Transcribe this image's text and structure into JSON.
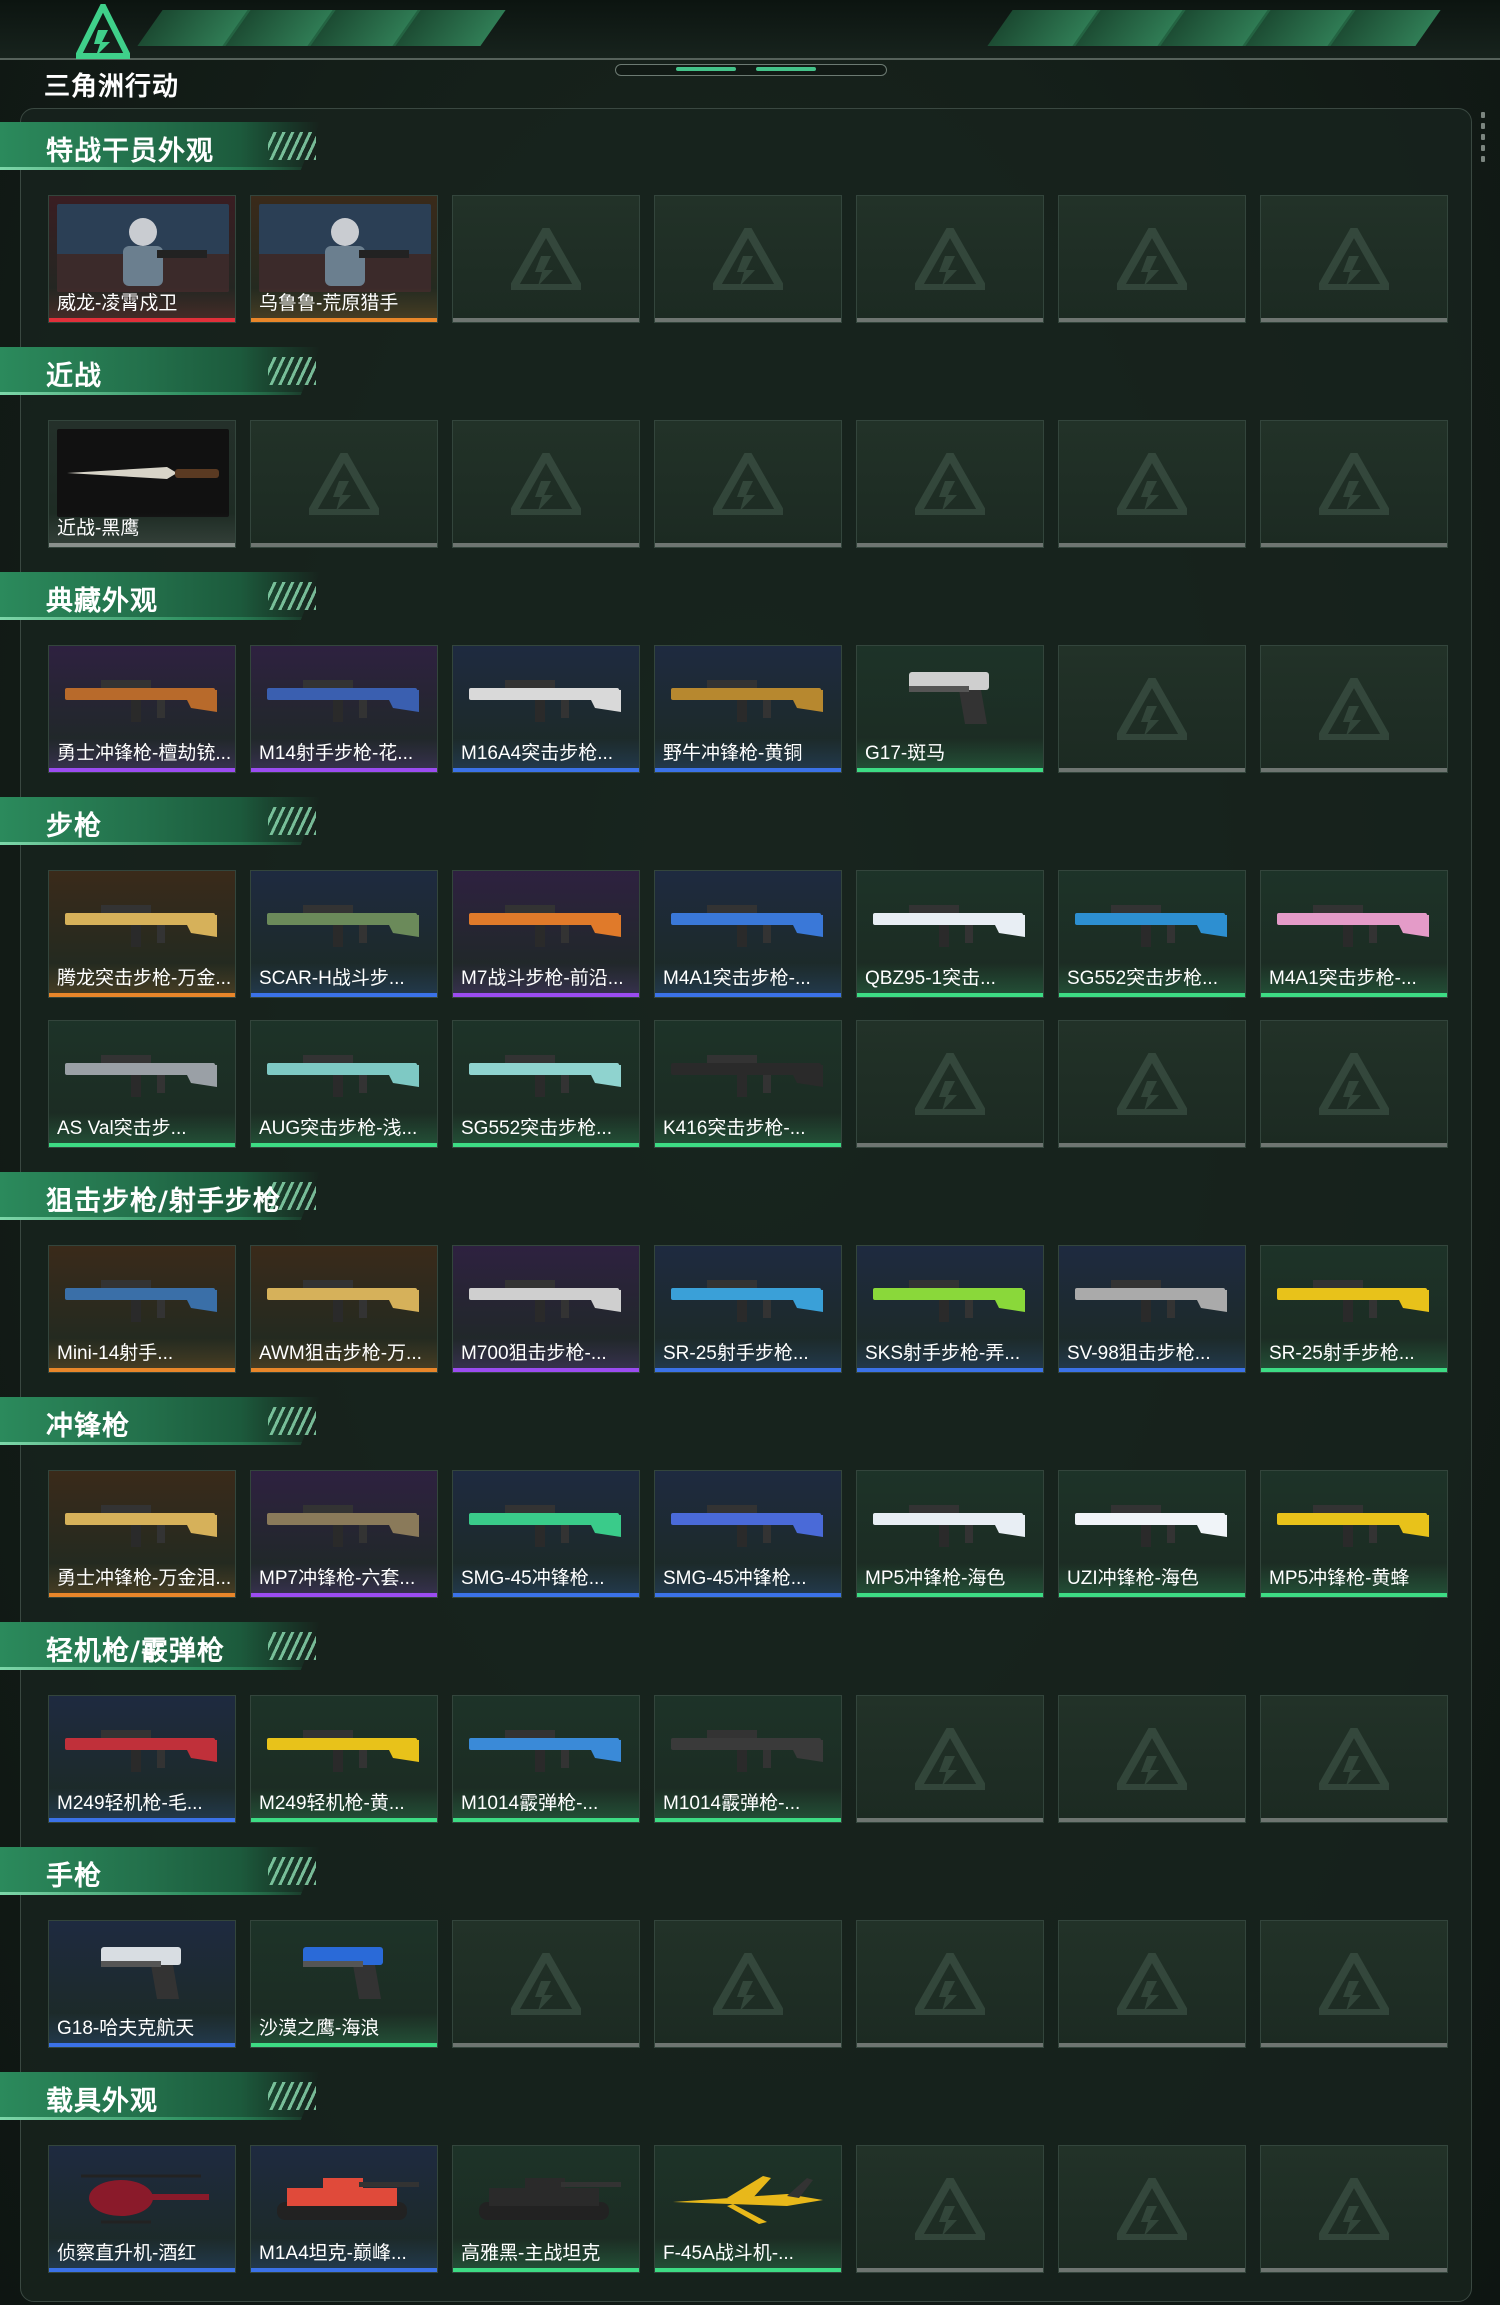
{
  "app": {
    "logo_text": "三角洲行动"
  },
  "rarity_colors": {
    "red": "#e0303a",
    "orange": "#e8862a",
    "purple": "#9b4cf0",
    "blue": "#3b72e8",
    "green": "#3ddc84",
    "gray": "#8a918d"
  },
  "sections": [
    {
      "title": "特战干员外观",
      "items": [
        {
          "label": "威龙-凌霄戍卫",
          "rarity": "red",
          "icon": "operator-portrait"
        },
        {
          "label": "乌鲁鲁-荒原猎手",
          "rarity": "orange",
          "icon": "operator-portrait"
        }
      ]
    },
    {
      "title": "近战",
      "items": [
        {
          "label": "近战-黑鹰",
          "rarity": "gray",
          "icon": "knife-icon"
        }
      ]
    },
    {
      "title": "典藏外观",
      "items": [
        {
          "label": "勇士冲锋枪-檀劫铳...",
          "rarity": "purple",
          "icon": "smg-icon",
          "color": "#b86a2b"
        },
        {
          "label": "M14射手步枪-花...",
          "rarity": "purple",
          "icon": "rifle-icon",
          "color": "#3a5fb0"
        },
        {
          "label": "M16A4突击步枪...",
          "rarity": "blue",
          "icon": "rifle-icon",
          "color": "#d9d9d9"
        },
        {
          "label": "野牛冲锋枪-黄铜",
          "rarity": "blue",
          "icon": "smg-icon",
          "color": "#b7882f"
        },
        {
          "label": "G17-斑马",
          "rarity": "green",
          "icon": "pistol-icon",
          "color": "#cfcfcf"
        }
      ]
    },
    {
      "title": "步枪",
      "rows": [
        [
          {
            "label": "腾龙突击步枪-万金...",
            "rarity": "orange",
            "icon": "rifle-icon",
            "color": "#d6b15a"
          },
          {
            "label": "SCAR-H战斗步...",
            "rarity": "blue",
            "icon": "rifle-icon",
            "color": "#6b8a5a"
          },
          {
            "label": "M7战斗步枪-前沿...",
            "rarity": "purple",
            "icon": "rifle-icon",
            "color": "#e07a2a"
          },
          {
            "label": "M4A1突击步枪-...",
            "rarity": "blue",
            "icon": "rifle-icon",
            "color": "#3a78d8"
          },
          {
            "label": "QBZ95-1突击...",
            "rarity": "green",
            "icon": "rifle-icon",
            "color": "#e8eef4"
          },
          {
            "label": "SG552突击步枪...",
            "rarity": "green",
            "icon": "rifle-icon",
            "color": "#2d8fd1"
          },
          {
            "label": "M4A1突击步枪-...",
            "rarity": "green",
            "icon": "rifle-icon",
            "color": "#e49bc8"
          }
        ],
        [
          {
            "label": "AS Val突击步...",
            "rarity": "green",
            "icon": "rifle-icon",
            "color": "#9aa0a6"
          },
          {
            "label": "AUG突击步枪-浅...",
            "rarity": "green",
            "icon": "rifle-icon",
            "color": "#7ec9c4"
          },
          {
            "label": "SG552突击步枪...",
            "rarity": "green",
            "icon": "rifle-icon",
            "color": "#8fd3cf"
          },
          {
            "label": "K416突击步枪-...",
            "rarity": "green",
            "icon": "rifle-icon",
            "color": "#2a2a2a"
          }
        ]
      ]
    },
    {
      "title": "狙击步枪/射手步枪",
      "items": [
        {
          "label": "Mini-14射手...",
          "rarity": "orange",
          "icon": "sniper-icon",
          "color": "#3a6fa8"
        },
        {
          "label": "AWM狙击步枪-万...",
          "rarity": "orange",
          "icon": "sniper-icon",
          "color": "#d6b15a"
        },
        {
          "label": "M700狙击步枪-...",
          "rarity": "purple",
          "icon": "sniper-icon",
          "color": "#cfcfcf"
        },
        {
          "label": "SR-25射手步枪...",
          "rarity": "blue",
          "icon": "sniper-icon",
          "color": "#3aa0d8"
        },
        {
          "label": "SKS射手步枪-弄...",
          "rarity": "blue",
          "icon": "sniper-icon",
          "color": "#8ad83a"
        },
        {
          "label": "SV-98狙击步枪...",
          "rarity": "blue",
          "icon": "sniper-icon",
          "color": "#aaaaaa"
        },
        {
          "label": "SR-25射手步枪...",
          "rarity": "green",
          "icon": "sniper-icon",
          "color": "#e8c21a"
        }
      ]
    },
    {
      "title": "冲锋枪",
      "items": [
        {
          "label": "勇士冲锋枪-万金泪...",
          "rarity": "orange",
          "icon": "smg-icon",
          "color": "#d6b15a"
        },
        {
          "label": "MP7冲锋枪-六套...",
          "rarity": "purple",
          "icon": "smg-icon",
          "color": "#8a7a5a"
        },
        {
          "label": "SMG-45冲锋枪...",
          "rarity": "blue",
          "icon": "smg-icon",
          "color": "#3acb8a"
        },
        {
          "label": "SMG-45冲锋枪...",
          "rarity": "blue",
          "icon": "smg-icon",
          "color": "#4a6ad8"
        },
        {
          "label": "MP5冲锋枪-海色",
          "rarity": "green",
          "icon": "smg-icon",
          "color": "#e8eef4"
        },
        {
          "label": "UZI冲锋枪-海色",
          "rarity": "green",
          "icon": "smg-icon",
          "color": "#f0f4f8"
        },
        {
          "label": "MP5冲锋枪-黄蜂",
          "rarity": "green",
          "icon": "smg-icon",
          "color": "#e8c21a"
        }
      ]
    },
    {
      "title": "轻机枪/霰弹枪",
      "items": [
        {
          "label": "M249轻机枪-毛...",
          "rarity": "blue",
          "icon": "lmg-icon",
          "color": "#c0303a"
        },
        {
          "label": "M249轻机枪-黄...",
          "rarity": "green",
          "icon": "lmg-icon",
          "color": "#e8c21a"
        },
        {
          "label": "M1014霰弹枪-...",
          "rarity": "green",
          "icon": "shotgun-icon",
          "color": "#3a8ad8"
        },
        {
          "label": "M1014霰弹枪-...",
          "rarity": "green",
          "icon": "shotgun-icon",
          "color": "#3a3a3a"
        }
      ]
    },
    {
      "title": "手枪",
      "items": [
        {
          "label": "G18-哈夫克航天",
          "rarity": "blue",
          "icon": "pistol-icon",
          "color": "#d8dde2"
        },
        {
          "label": "沙漠之鹰-海浪",
          "rarity": "green",
          "icon": "pistol-icon",
          "color": "#2a6ad8"
        }
      ]
    },
    {
      "title": "载具外观",
      "items": [
        {
          "label": "侦察直升机-酒红",
          "rarity": "blue",
          "icon": "helicopter-icon",
          "color": "#8a1a2a"
        },
        {
          "label": "M1A4坦克-巅峰...",
          "rarity": "blue",
          "icon": "tank-icon",
          "color": "#e04a3a"
        },
        {
          "label": "高雅黑-主战坦克",
          "rarity": "green",
          "icon": "tank-icon",
          "color": "#2a2a2a"
        },
        {
          "label": "F-45A战斗机-...",
          "rarity": "green",
          "icon": "jet-icon",
          "color": "#e8b81a"
        }
      ]
    }
  ]
}
